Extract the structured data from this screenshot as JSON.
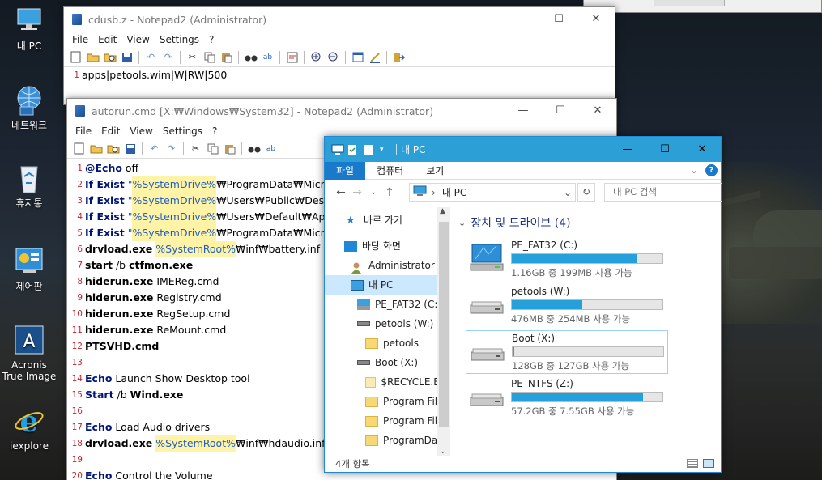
{
  "desktop": {
    "icons": [
      {
        "label": "내 PC"
      },
      {
        "label": "네트워크"
      },
      {
        "label": "휴지통"
      },
      {
        "label": "제어판"
      },
      {
        "label": "Acronis True Image"
      },
      {
        "label": "iexplore"
      }
    ]
  },
  "notepad1": {
    "title": "cdusb.z - Notepad2 (Administrator)",
    "menu": [
      "File",
      "Edit",
      "View",
      "Settings",
      "?"
    ],
    "lines": [
      {
        "n": "1",
        "text": "apps|petools.wim|W|RW|500"
      }
    ]
  },
  "notepad2": {
    "title": "autorun.cmd [X:₩Windows₩System32] - Notepad2 (Administrator)",
    "menu": [
      "File",
      "Edit",
      "View",
      "Settings",
      "?"
    ],
    "lines": [
      {
        "n": "1",
        "a": "@Echo",
        "b": " off",
        "c": "",
        "d": ""
      },
      {
        "n": "2",
        "a": "If Exist",
        "b": " \"",
        "c": "%SystemDrive%",
        "d": "₩ProgramData₩Micro"
      },
      {
        "n": "3",
        "a": "If Exist",
        "b": " \"",
        "c": "%SystemDrive%",
        "d": "₩Users₩Public₩Des"
      },
      {
        "n": "4",
        "a": "If Exist",
        "b": " \"",
        "c": "%SystemDrive%",
        "d": "₩Users₩Default₩App"
      },
      {
        "n": "5",
        "a": "If Exist",
        "b": " \"",
        "c": "%SystemDrive%",
        "d": "₩ProgramData₩Micro"
      },
      {
        "n": "6",
        "a": "drvload.exe",
        "b": " ",
        "c": "%SystemRoot%",
        "d": "₩inf₩battery.inf"
      },
      {
        "n": "7",
        "a": "start",
        "b": " /b ",
        "c": "",
        "d": "ctfmon.exe"
      },
      {
        "n": "8",
        "a": "hiderun.exe",
        "b": " IMEReg.cmd",
        "c": "",
        "d": ""
      },
      {
        "n": "9",
        "a": "hiderun.exe",
        "b": " Registry.cmd",
        "c": "",
        "d": ""
      },
      {
        "n": "10",
        "a": "hiderun.exe",
        "b": " RegSetup.cmd",
        "c": "",
        "d": ""
      },
      {
        "n": "11",
        "a": "hiderun.exe",
        "b": " ReMount.cmd",
        "c": "",
        "d": ""
      },
      {
        "n": "12",
        "a": "PTSVHD.cmd",
        "b": "",
        "c": "",
        "d": ""
      },
      {
        "n": "13",
        "a": "",
        "b": "",
        "c": "",
        "d": ""
      },
      {
        "n": "14",
        "a": "Echo",
        "b": " Launch Show Desktop tool",
        "c": "",
        "d": ""
      },
      {
        "n": "15",
        "a": "Start",
        "b": " /b ",
        "c": "",
        "d": "Wind.exe"
      },
      {
        "n": "16",
        "a": "",
        "b": "",
        "c": "",
        "d": ""
      },
      {
        "n": "17",
        "a": "Echo",
        "b": " Load Audio drivers",
        "c": "",
        "d": ""
      },
      {
        "n": "18",
        "a": "drvload.exe",
        "b": " ",
        "c": "%SystemRoot%",
        "d": "₩inf₩hdaudio.inf"
      },
      {
        "n": "19",
        "a": "",
        "b": "",
        "c": "",
        "d": ""
      },
      {
        "n": "20",
        "a": "Echo",
        "b": " Control the Volume",
        "c": "",
        "d": ""
      }
    ]
  },
  "explorer": {
    "title": "내 PC",
    "tabs": [
      "파일",
      "컴퓨터",
      "보기"
    ],
    "address": "내 PC",
    "address_sep": "›",
    "search_placeholder": "내 PC 검색",
    "nav": [
      {
        "label": "바로 가기",
        "icon": "star-icon"
      },
      {
        "label": "바탕 화면",
        "icon": "desktop-icon"
      },
      {
        "label": "Administrator",
        "icon": "user-icon"
      },
      {
        "label": "내 PC",
        "icon": "pc-icon"
      },
      {
        "label": "PE_FAT32 (C:)",
        "icon": "system-drive-icon"
      },
      {
        "label": "petools (W:)",
        "icon": "drive-icon"
      },
      {
        "label": "petools",
        "icon": "folder-icon"
      },
      {
        "label": "Boot (X:)",
        "icon": "drive-icon"
      },
      {
        "label": "$RECYCLE.BIN",
        "icon": "folder-icon"
      },
      {
        "label": "Program Files",
        "icon": "folder-icon"
      },
      {
        "label": "Program Files",
        "icon": "folder-icon"
      },
      {
        "label": "ProgramData",
        "icon": "folder-icon"
      }
    ],
    "group_title": "장치 및 드라이브 (4)",
    "drives": [
      {
        "name": "PE_FAT32 (C:)",
        "size": "1.16GB 중 199MB 사용 가능",
        "used_fraction": 0.83
      },
      {
        "name": "petools (W:)",
        "size": "476MB 중 254MB 사용 가능",
        "used_fraction": 0.47
      },
      {
        "name": "Boot (X:)",
        "size": "128GB 중 127GB 사용 가능",
        "used_fraction": 0.01
      },
      {
        "name": "PE_NTFS (Z:)",
        "size": "57.2GB 중 7.55GB 사용 가능",
        "used_fraction": 0.87
      }
    ],
    "status": "4개 항목"
  },
  "colors": {
    "accent": "#2b9fd6",
    "ribbon_active": "#1979ca",
    "bar": "#26a0da"
  }
}
